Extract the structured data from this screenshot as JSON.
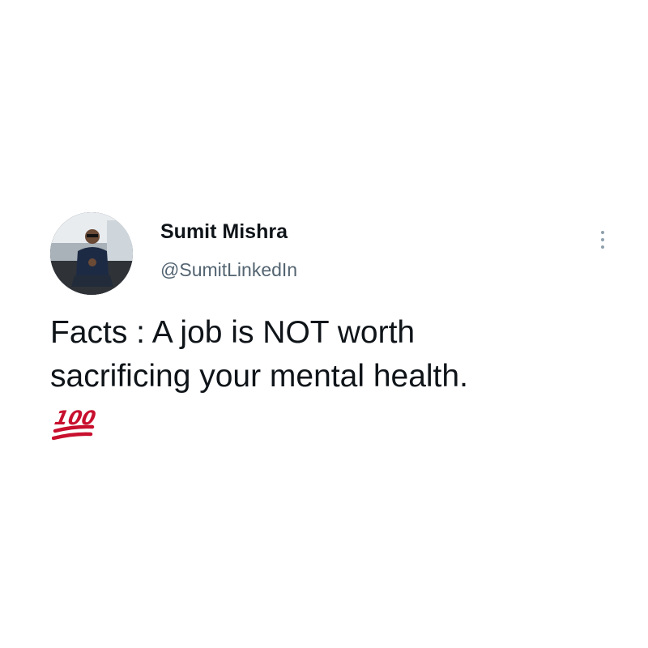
{
  "tweet": {
    "author": {
      "display_name": "Sumit Mishra",
      "handle": "@SumitLinkedIn"
    },
    "text_lines": [
      "Facts : A job is NOT worth",
      "sacrificing your mental health."
    ],
    "emoji": {
      "name": "hundred-points-emoji",
      "label": "100",
      "color": "#c8102e"
    },
    "more_icon": "more-options-vertical-icon"
  },
  "colors": {
    "background": "#ffffff",
    "text_primary": "#0f1419",
    "text_secondary": "#536471",
    "more_dots": "#8fa0ad"
  }
}
